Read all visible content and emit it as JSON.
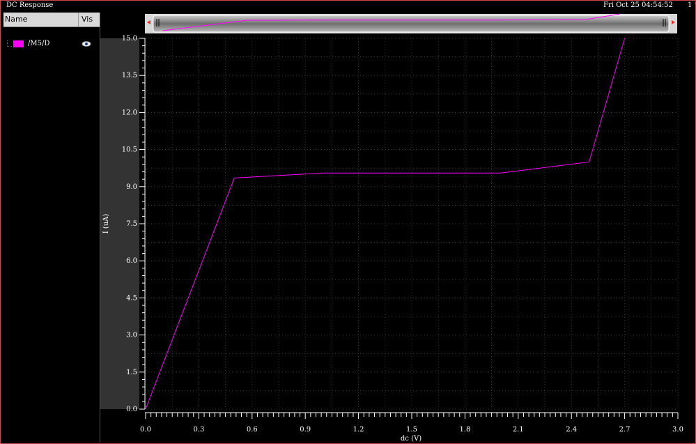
{
  "window": {
    "title": "DC Response",
    "timestamp": "Fri Oct 25 04:54:52",
    "page_number": "1"
  },
  "legend": {
    "columns": {
      "name": "Name",
      "vis": "Vis"
    },
    "items": [
      {
        "label": "/M5/D",
        "color": "#ff00ff",
        "visible_icon": "eye-icon"
      }
    ]
  },
  "colors": {
    "trace": "#ff00ff",
    "background": "#000000",
    "grid": "#555555",
    "frame": "#c94a4a"
  },
  "chart_data": {
    "type": "line",
    "xlabel": "dc (V)",
    "ylabel": "I (uA)",
    "xlim": [
      0.0,
      3.0
    ],
    "ylim": [
      0.0,
      15.0
    ],
    "xticks": [
      "0.0",
      "0.3",
      "0.6",
      "0.9",
      "1.2",
      "1.5",
      "1.8",
      "2.1",
      "2.4",
      "2.7",
      "3.0"
    ],
    "yticks": [
      "0.0",
      "1.5",
      "3.0",
      "4.5",
      "6.0",
      "7.5",
      "9.0",
      "10.5",
      "12.0",
      "13.5",
      "15.0"
    ],
    "grid": true,
    "series": [
      {
        "name": "/M5/D",
        "x": [
          0.0,
          0.5,
          1.0,
          1.5,
          2.0,
          2.5,
          2.7
        ],
        "y": [
          0.0,
          9.35,
          9.55,
          9.55,
          9.55,
          10.0,
          15.0
        ]
      }
    ]
  }
}
